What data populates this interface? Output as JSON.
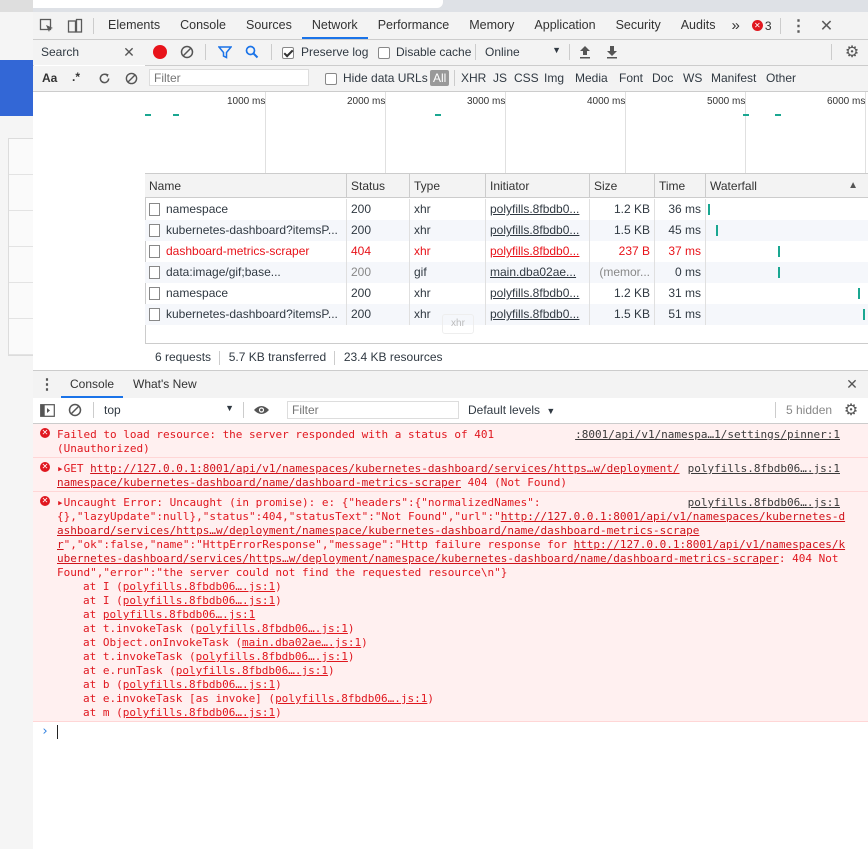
{
  "main_tabs": {
    "items": [
      "Elements",
      "Console",
      "Sources",
      "Network",
      "Performance",
      "Memory",
      "Application",
      "Security",
      "Audits"
    ],
    "active": "Network",
    "more": "»",
    "error_count": "3"
  },
  "search_pane": {
    "title": "Search",
    "aa": "Aa",
    "regex": ".*"
  },
  "net_toolbar": {
    "preserve_log": "Preserve log",
    "disable_cache": "Disable cache",
    "throttle": "Online"
  },
  "filter_bar": {
    "placeholder": "Filter",
    "hide_data_urls": "Hide data URLs",
    "types": [
      "All",
      "XHR",
      "JS",
      "CSS",
      "Img",
      "Media",
      "Font",
      "Doc",
      "WS",
      "Manifest",
      "Other"
    ]
  },
  "overview": {
    "ticks": [
      "1000 ms",
      "2000 ms",
      "3000 ms",
      "4000 ms",
      "5000 ms",
      "6000 ms"
    ]
  },
  "table": {
    "headers": [
      "Name",
      "Status",
      "Type",
      "Initiator",
      "Size",
      "Time",
      "Waterfall"
    ],
    "rows": [
      {
        "name": "namespace",
        "status": "200",
        "type": "xhr",
        "initiator": "polyfills.8fbdb0...",
        "size": "1.2 KB",
        "time": "36 ms",
        "error": false,
        "wf": 0.0
      },
      {
        "name": "kubernetes-dashboard?itemsP...",
        "status": "200",
        "type": "xhr",
        "initiator": "polyfills.8fbdb0...",
        "size": "1.5 KB",
        "time": "45 ms",
        "error": false,
        "wf": 0.05
      },
      {
        "name": "dashboard-metrics-scraper",
        "status": "404",
        "type": "xhr",
        "initiator": "polyfills.8fbdb0...",
        "size": "237 B",
        "time": "37 ms",
        "error": true,
        "wf": 0.45
      },
      {
        "name": "data:image/gif;base...",
        "status": "200",
        "type": "gif",
        "initiator": "main.dba02ae...",
        "size": "(memor...",
        "time": "0 ms",
        "error": false,
        "wf": 0.45
      },
      {
        "name": "namespace",
        "status": "200",
        "type": "xhr",
        "initiator": "polyfills.8fbdb0...",
        "size": "1.2 KB",
        "time": "31 ms",
        "error": false,
        "wf": 0.97
      },
      {
        "name": "kubernetes-dashboard?itemsP...",
        "status": "200",
        "type": "xhr",
        "initiator": "polyfills.8fbdb0...",
        "size": "1.5 KB",
        "time": "51 ms",
        "error": false,
        "wf": 1.0
      }
    ],
    "ghost": "xhr"
  },
  "status_bar": {
    "requests": "6 requests",
    "transferred": "5.7 KB transferred",
    "resources": "23.4 KB resources"
  },
  "drawer": {
    "tabs": [
      "Console",
      "What's New"
    ]
  },
  "console_toolbar": {
    "context": "top",
    "filter_placeholder": "Filter",
    "levels": "Default levels",
    "hidden": "5 hidden"
  },
  "console": {
    "m1_text": "Failed to load resource: the server responded with a status of 401",
    "m1_text2": "(Unauthorized)",
    "m1_src": ":8001/api/v1/namespa…1/settings/pinner:1",
    "m2_prefix": "▸GET ",
    "m2_url": "http://127.0.0.1:8001/api/v1/namespaces/kubernetes-dashboard/services/https…w/deployment/",
    "m2_url2": "namespace/kubernetes-dashboard/name/dashboard-metrics-scraper",
    "m2_suffix": " 404 (Not Found)",
    "m2_src": "polyfills.8fbdb06….js:1",
    "m3_src": "polyfills.8fbdb06….js:1",
    "m3_l1": "▸Uncaught Error: Uncaught (in promise): e: {\"headers\":{\"normalizedNames\":",
    "m3_l2a": "{},\"lazyUpdate\":null},\"status\":404,\"statusText\":\"Not Found\",\"url\":\"",
    "m3_l2b": "http://127.0.0.1:8001/api/v1/namespaces/kubernetes-d",
    "m3_l3": "ashboard/services/https…w/deployment/namespace/kubernetes-dashboard/name/dashboard-metrics-scrape",
    "m3_l4a": "r",
    "m3_l4b": "\",\"ok\":false,\"name\":\"HttpErrorResponse\",\"message\":\"Http failure response for ",
    "m3_l4c": "http://127.0.0.1:8001/api/v1/namespaces/k",
    "m3_l5a": "ubernetes-dashboard/services/https…w/deployment/namespace/kubernetes-dashboard/name/dashboard-metrics-scraper",
    "m3_l5b": ": 404 Not",
    "m3_l6": "Found\",\"error\":\"the server could not find the requested resource\\n\"}",
    "stack": [
      {
        "pre": "at I (",
        "link": "polyfills.8fbdb06….js:1",
        "post": ")"
      },
      {
        "pre": "at I (",
        "link": "polyfills.8fbdb06….js:1",
        "post": ")"
      },
      {
        "pre": "at ",
        "link": "polyfills.8fbdb06….js:1",
        "post": ""
      },
      {
        "pre": "at t.invokeTask (",
        "link": "polyfills.8fbdb06….js:1",
        "post": ")"
      },
      {
        "pre": "at Object.onInvokeTask (",
        "link": "main.dba02ae….js:1",
        "post": ")"
      },
      {
        "pre": "at t.invokeTask (",
        "link": "polyfills.8fbdb06….js:1",
        "post": ")"
      },
      {
        "pre": "at e.runTask (",
        "link": "polyfills.8fbdb06….js:1",
        "post": ")"
      },
      {
        "pre": "at b (",
        "link": "polyfills.8fbdb06….js:1",
        "post": ")"
      },
      {
        "pre": "at e.invokeTask [as invoke] (",
        "link": "polyfills.8fbdb06….js:1",
        "post": ")"
      },
      {
        "pre": "at m (",
        "link": "polyfills.8fbdb06….js:1",
        "post": ")"
      }
    ],
    "prompt": "›"
  }
}
